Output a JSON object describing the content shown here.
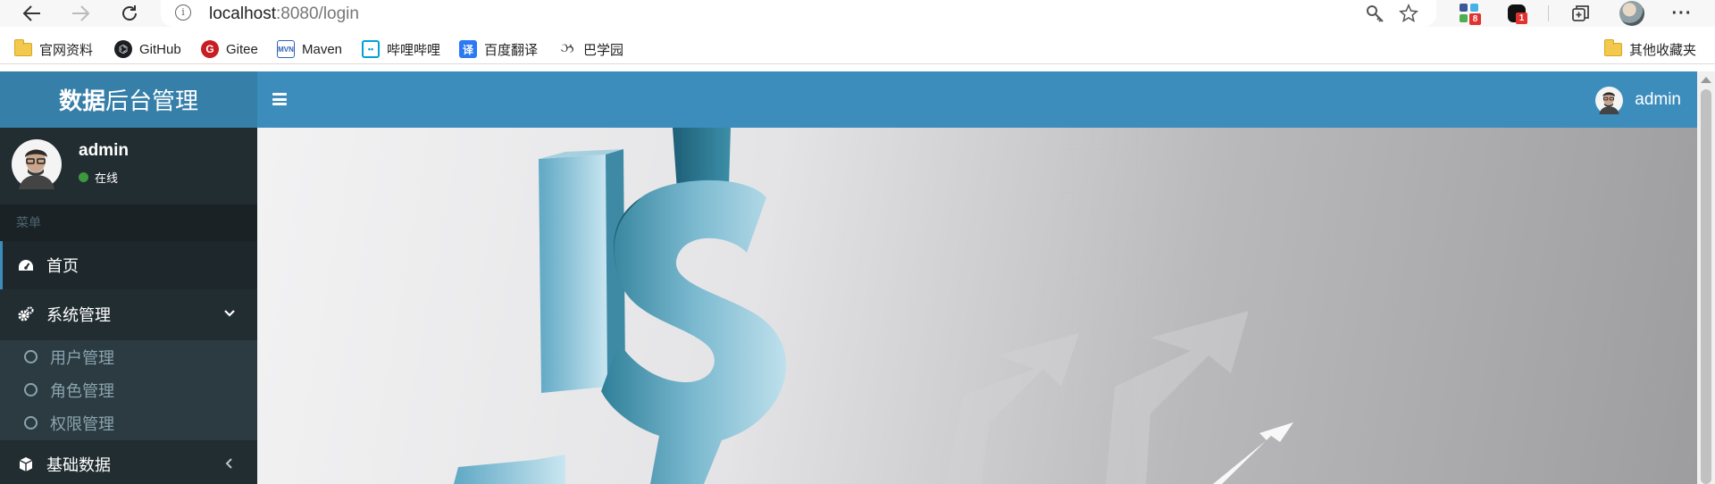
{
  "browser": {
    "url_host": "localhost",
    "url_rest": ":8080/login",
    "badges": {
      "extension_1": "8",
      "extension_2": "1"
    },
    "more_label": "···"
  },
  "bookmarks": [
    {
      "label": "官网资料",
      "icon": "folder-icon"
    },
    {
      "label": "GitHub",
      "icon": "github-icon"
    },
    {
      "label": "Gitee",
      "icon": "gitee-icon"
    },
    {
      "label": "Maven",
      "icon": "maven-icon"
    },
    {
      "label": "哔哩哔哩",
      "icon": "bilibili-icon"
    },
    {
      "label": "百度翻译",
      "icon": "translate-icon"
    },
    {
      "label": "巴学园",
      "icon": "bxy-icon"
    }
  ],
  "bookmarks_other": {
    "label": "其他收藏夹",
    "icon": "folder-icon"
  },
  "app": {
    "brand_bold": "数据",
    "brand_rest": "后台管理",
    "nav_user": "admin"
  },
  "sidebar": {
    "user_name": "admin",
    "user_status": "在线",
    "menu_header": "菜单",
    "items": [
      {
        "label": "首页",
        "icon": "dashboard-icon"
      },
      {
        "label": "系统管理",
        "icon": "cogs-icon",
        "expanded": true
      },
      {
        "label": "基础数据",
        "icon": "cube-icon",
        "expanded": false
      }
    ],
    "subitems": [
      {
        "label": "用户管理"
      },
      {
        "label": "角色管理"
      },
      {
        "label": "权限管理"
      }
    ]
  },
  "colors": {
    "navbar": "#3c8dbc",
    "brand": "#367fa9",
    "sidebar": "#222d32",
    "submenu": "#2c3b41",
    "status_online": "#3c9a3c"
  }
}
